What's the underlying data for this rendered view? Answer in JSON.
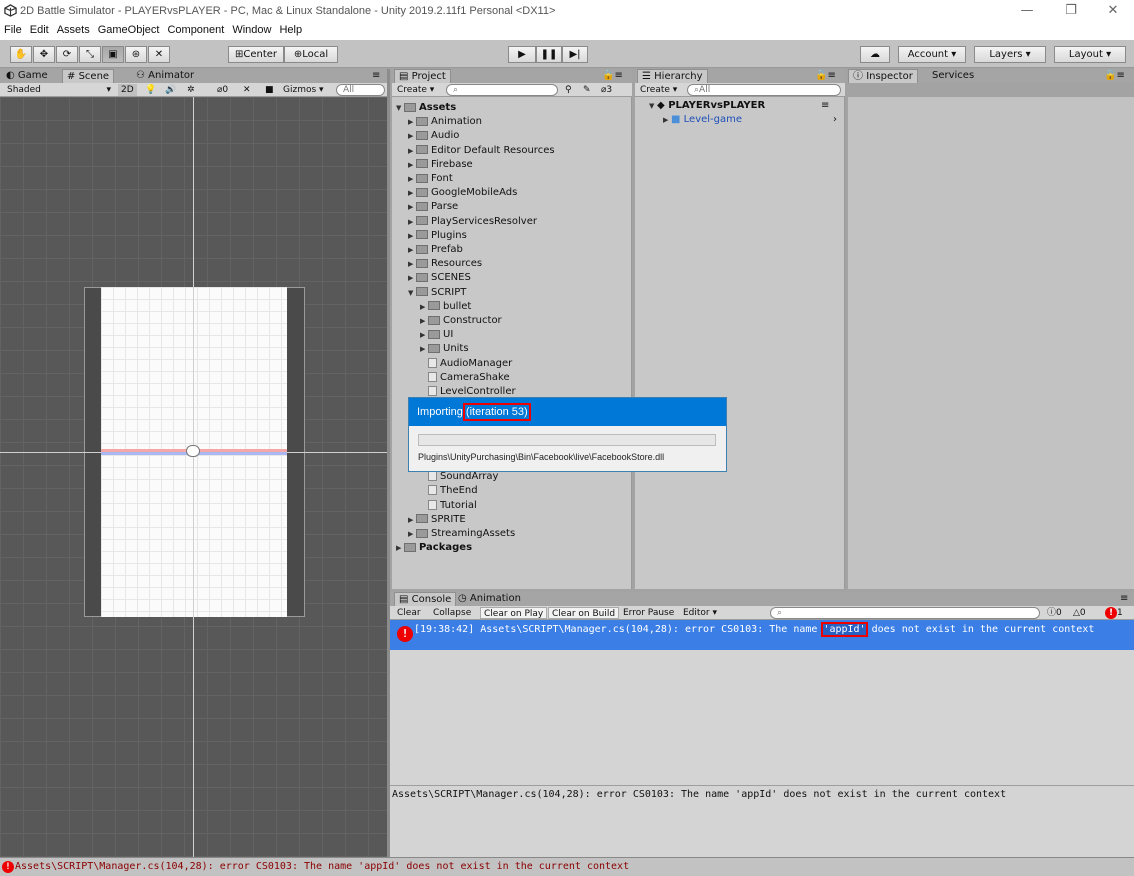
{
  "window": {
    "title": "2D Battle Simulator - PLAYERvsPLAYER - PC, Mac & Linux Standalone - Unity 2019.2.11f1 Personal <DX11>",
    "minimize": "—",
    "restore": "❐",
    "close": "✕"
  },
  "menu": [
    "File",
    "Edit",
    "Assets",
    "GameObject",
    "Component",
    "Window",
    "Help"
  ],
  "toolbar": {
    "center": "Center",
    "local": "Local",
    "account": "Account",
    "layers": "Layers",
    "layout": "Layout"
  },
  "scene_tabs": {
    "game": "Game",
    "scene": "Scene",
    "animator": "Animator"
  },
  "scene_toolbar": {
    "shading": "Shaded",
    "mode2d": "2D",
    "hidden_count": "0",
    "gizmos": "Gizmos"
  },
  "project": {
    "tab": "Project",
    "create": "Create",
    "badge": "3",
    "tree": [
      {
        "label": "Assets",
        "level": 0,
        "type": "root",
        "open": true
      },
      {
        "label": "Animation",
        "level": 1,
        "type": "folder"
      },
      {
        "label": "Audio",
        "level": 1,
        "type": "folder"
      },
      {
        "label": "Editor Default Resources",
        "level": 1,
        "type": "folder"
      },
      {
        "label": "Firebase",
        "level": 1,
        "type": "folder"
      },
      {
        "label": "Font",
        "level": 1,
        "type": "folder"
      },
      {
        "label": "GoogleMobileAds",
        "level": 1,
        "type": "folder"
      },
      {
        "label": "Parse",
        "level": 1,
        "type": "folder"
      },
      {
        "label": "PlayServicesResolver",
        "level": 1,
        "type": "folder"
      },
      {
        "label": "Plugins",
        "level": 1,
        "type": "folder"
      },
      {
        "label": "Prefab",
        "level": 1,
        "type": "folder"
      },
      {
        "label": "Resources",
        "level": 1,
        "type": "folder"
      },
      {
        "label": "SCENES",
        "level": 1,
        "type": "folder"
      },
      {
        "label": "SCRIPT",
        "level": 1,
        "type": "folder",
        "open": true
      },
      {
        "label": "bullet",
        "level": 2,
        "type": "folder"
      },
      {
        "label": "Constructor",
        "level": 2,
        "type": "folder"
      },
      {
        "label": "UI",
        "level": 2,
        "type": "folder"
      },
      {
        "label": "Units",
        "level": 2,
        "type": "folder"
      },
      {
        "label": "AudioManager",
        "level": 2,
        "type": "script"
      },
      {
        "label": "CameraShake",
        "level": 2,
        "type": "script"
      },
      {
        "label": "LevelController",
        "level": 2,
        "type": "script"
      },
      {
        "label": "",
        "level": 2,
        "type": "hidden"
      },
      {
        "label": "",
        "level": 2,
        "type": "hidden"
      },
      {
        "label": "",
        "level": 2,
        "type": "hidden"
      },
      {
        "label": "",
        "level": 2,
        "type": "hidden"
      },
      {
        "label": "",
        "level": 2,
        "type": "hidden"
      },
      {
        "label": "SoundArray",
        "level": 2,
        "type": "script"
      },
      {
        "label": "TheEnd",
        "level": 2,
        "type": "script"
      },
      {
        "label": "Tutorial",
        "level": 2,
        "type": "script"
      },
      {
        "label": "SPRITE",
        "level": 1,
        "type": "folder"
      },
      {
        "label": "StreamingAssets",
        "level": 1,
        "type": "folder"
      },
      {
        "label": "Packages",
        "level": 0,
        "type": "root"
      }
    ]
  },
  "hierarchy": {
    "tab": "Hierarchy",
    "create": "Create",
    "search": "All",
    "scene": "PLAYERvsPLAYER",
    "child": "Level-game"
  },
  "inspector": {
    "tab": "Inspector",
    "services": "Services"
  },
  "console": {
    "tab": "Console",
    "animation_tab": "Animation",
    "buttons": [
      "Clear",
      "Collapse",
      "Clear on Play",
      "Clear on Build",
      "Error Pause",
      "Editor"
    ],
    "counts": {
      "info": "0",
      "warn": "0",
      "error": "1"
    },
    "entry_time": "[19:38:42]",
    "entry_pre": "Assets\\SCRIPT\\Manager.cs(104,28): error CS0103: The name ",
    "entry_key": "'appId'",
    "entry_post": " does not exist in the current context",
    "detail": "Assets\\SCRIPT\\Manager.cs(104,28): error CS0103: The name 'appId' does not exist in the current context"
  },
  "import_dialog": {
    "prefix": "Importing ",
    "iteration": "(iteration 53)",
    "path": "Plugins\\UnityPurchasing\\Bin\\Facebook\\live\\FacebookStore.dll",
    "progress": 0
  },
  "statusbar": "Assets\\SCRIPT\\Manager.cs(104,28): error CS0103: The name 'appId' does not exist in the current context",
  "colors": {
    "selection": "#3a7ee6",
    "error": "#e00000",
    "dialog_header": "#0078d7"
  }
}
